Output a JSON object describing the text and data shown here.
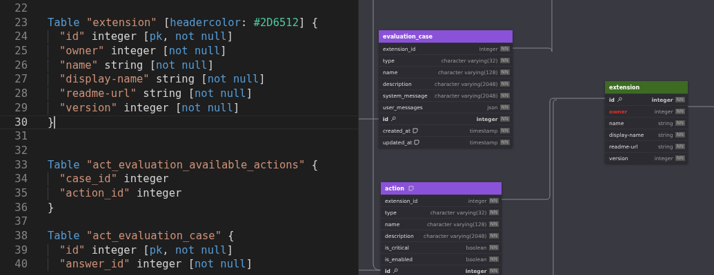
{
  "editor": {
    "lines": [
      {
        "number": "22",
        "current": false
      },
      {
        "number": "23",
        "current": false,
        "indented": false,
        "tokens": [
          {
            "kind": "keyword",
            "text": "Table "
          },
          {
            "kind": "string",
            "text": "\"extension\" "
          },
          {
            "kind": "plain",
            "text": "["
          },
          {
            "kind": "setting",
            "text": "headercolor"
          },
          {
            "kind": "plain",
            "text": ": "
          },
          {
            "kind": "color",
            "text": "#2D6512"
          },
          {
            "kind": "plain",
            "text": "] {"
          }
        ]
      },
      {
        "number": "24",
        "current": false,
        "indented": true,
        "tokens": [
          {
            "kind": "string",
            "text": "\"id\" "
          },
          {
            "kind": "plain",
            "text": "integer ["
          },
          {
            "kind": "setting",
            "text": "pk"
          },
          {
            "kind": "plain",
            "text": ", "
          },
          {
            "kind": "setting",
            "text": "not null"
          },
          {
            "kind": "plain",
            "text": "]"
          }
        ]
      },
      {
        "number": "25",
        "current": false,
        "indented": true,
        "tokens": [
          {
            "kind": "string",
            "text": "\"owner\" "
          },
          {
            "kind": "plain",
            "text": "integer ["
          },
          {
            "kind": "setting",
            "text": "not null"
          },
          {
            "kind": "plain",
            "text": "]"
          }
        ]
      },
      {
        "number": "26",
        "current": false,
        "indented": true,
        "tokens": [
          {
            "kind": "string",
            "text": "\"name\" "
          },
          {
            "kind": "plain",
            "text": "string ["
          },
          {
            "kind": "setting",
            "text": "not null"
          },
          {
            "kind": "plain",
            "text": "]"
          }
        ]
      },
      {
        "number": "27",
        "current": false,
        "indented": true,
        "tokens": [
          {
            "kind": "string",
            "text": "\"display-name\" "
          },
          {
            "kind": "plain",
            "text": "string ["
          },
          {
            "kind": "setting",
            "text": "not null"
          },
          {
            "kind": "plain",
            "text": "]"
          }
        ]
      },
      {
        "number": "28",
        "current": false,
        "indented": true,
        "tokens": [
          {
            "kind": "string",
            "text": "\"readme-url\" "
          },
          {
            "kind": "plain",
            "text": "string ["
          },
          {
            "kind": "setting",
            "text": "not null"
          },
          {
            "kind": "plain",
            "text": "]"
          }
        ]
      },
      {
        "number": "29",
        "current": false,
        "indented": true,
        "tokens": [
          {
            "kind": "string",
            "text": "\"version\" "
          },
          {
            "kind": "plain",
            "text": "integer ["
          },
          {
            "kind": "setting",
            "text": "not null"
          },
          {
            "kind": "plain",
            "text": "]"
          }
        ]
      },
      {
        "number": "30",
        "current": true,
        "indented": false,
        "tokens": [
          {
            "kind": "plain",
            "text": "}"
          }
        ]
      },
      {
        "number": "31",
        "current": false
      },
      {
        "number": "32",
        "current": false
      },
      {
        "number": "33",
        "current": false,
        "indented": false,
        "tokens": [
          {
            "kind": "keyword",
            "text": "Table "
          },
          {
            "kind": "string",
            "text": "\"act_evaluation_available_actions\" "
          },
          {
            "kind": "plain",
            "text": "{"
          }
        ]
      },
      {
        "number": "34",
        "current": false,
        "indented": true,
        "tokens": [
          {
            "kind": "string",
            "text": "\"case_id\" "
          },
          {
            "kind": "plain",
            "text": "integer"
          }
        ]
      },
      {
        "number": "35",
        "current": false,
        "indented": true,
        "tokens": [
          {
            "kind": "string",
            "text": "\"action_id\" "
          },
          {
            "kind": "plain",
            "text": "integer"
          }
        ]
      },
      {
        "number": "36",
        "current": false,
        "indented": false,
        "tokens": [
          {
            "kind": "plain",
            "text": "}"
          }
        ]
      },
      {
        "number": "37",
        "current": false
      },
      {
        "number": "38",
        "current": false,
        "indented": false,
        "tokens": [
          {
            "kind": "keyword",
            "text": "Table "
          },
          {
            "kind": "string",
            "text": "\"act_evaluation_case\" "
          },
          {
            "kind": "plain",
            "text": "{"
          }
        ]
      },
      {
        "number": "39",
        "current": false,
        "indented": true,
        "tokens": [
          {
            "kind": "string",
            "text": "\"id\" "
          },
          {
            "kind": "plain",
            "text": "integer ["
          },
          {
            "kind": "setting",
            "text": "pk"
          },
          {
            "kind": "plain",
            "text": ", "
          },
          {
            "kind": "setting",
            "text": "not null"
          },
          {
            "kind": "plain",
            "text": "]"
          }
        ]
      },
      {
        "number": "40",
        "current": false,
        "indented": true,
        "tokens": [
          {
            "kind": "string",
            "text": "\"answer_id\" "
          },
          {
            "kind": "plain",
            "text": "integer ["
          },
          {
            "kind": "setting",
            "text": "not null"
          },
          {
            "kind": "plain",
            "text": "]"
          }
        ]
      }
    ]
  },
  "diagram": {
    "tables": [
      {
        "name": "evaluation_case",
        "color": "#8a52d9",
        "note": false,
        "fields": [
          {
            "name": "extension_id",
            "type": "integer",
            "nn": "NN",
            "pk": false,
            "note": false,
            "highlighted": false
          },
          {
            "name": "type",
            "type": "character varying(32)",
            "nn": "NN",
            "pk": false,
            "note": false,
            "highlighted": false
          },
          {
            "name": "name",
            "type": "character varying(128)",
            "nn": "NN",
            "pk": false,
            "note": false,
            "highlighted": false
          },
          {
            "name": "description",
            "type": "character varying(2048)",
            "nn": "NN",
            "pk": false,
            "note": false,
            "highlighted": false
          },
          {
            "name": "system_message",
            "type": "character varying(2048)",
            "nn": "NN",
            "pk": false,
            "note": false,
            "highlighted": false
          },
          {
            "name": "user_messages",
            "type": "json",
            "nn": "NN",
            "pk": false,
            "note": false,
            "highlighted": false
          },
          {
            "name": "id",
            "type": "integer",
            "nn": "NN",
            "pk": true,
            "note": false,
            "highlighted": false
          },
          {
            "name": "created_at",
            "type": "timestamp",
            "nn": "NN",
            "pk": false,
            "note": true,
            "highlighted": false
          },
          {
            "name": "updated_at",
            "type": "timestamp",
            "nn": "NN",
            "pk": false,
            "note": true,
            "highlighted": false
          }
        ]
      },
      {
        "name": "action",
        "color": "#8a52d9",
        "note": true,
        "fields": [
          {
            "name": "extension_id",
            "type": "integer",
            "nn": "NN",
            "pk": false,
            "note": false,
            "highlighted": false
          },
          {
            "name": "type",
            "type": "character varying(32)",
            "nn": "NN",
            "pk": false,
            "note": false,
            "highlighted": false
          },
          {
            "name": "name",
            "type": "character varying(128)",
            "nn": "NN",
            "pk": false,
            "note": false,
            "highlighted": false
          },
          {
            "name": "description",
            "type": "character varying(2048)",
            "nn": "NN",
            "pk": false,
            "note": false,
            "highlighted": false
          },
          {
            "name": "is_critical",
            "type": "boolean",
            "nn": "NN",
            "pk": false,
            "note": false,
            "highlighted": false
          },
          {
            "name": "is_enabled",
            "type": "boolean",
            "nn": "NN",
            "pk": false,
            "note": false,
            "highlighted": false
          },
          {
            "name": "id",
            "type": "integer",
            "nn": "NN",
            "pk": true,
            "note": false,
            "highlighted": false
          }
        ]
      },
      {
        "name": "extension",
        "color": "#3d6b22",
        "note": false,
        "fields": [
          {
            "name": "id",
            "type": "integer",
            "nn": "NN",
            "pk": true,
            "note": false,
            "highlighted": false
          },
          {
            "name": "owner",
            "type": "integer",
            "nn": "NN",
            "pk": false,
            "note": false,
            "highlighted": true
          },
          {
            "name": "name",
            "type": "string",
            "nn": "NN",
            "pk": false,
            "note": false,
            "highlighted": false
          },
          {
            "name": "display-name",
            "type": "string",
            "nn": "NN",
            "pk": false,
            "note": false,
            "highlighted": false
          },
          {
            "name": "readme-url",
            "type": "string",
            "nn": "NN",
            "pk": false,
            "note": false,
            "highlighted": false
          },
          {
            "name": "version",
            "type": "integer",
            "nn": "NN",
            "pk": false,
            "note": false,
            "highlighted": false
          }
        ]
      }
    ]
  }
}
